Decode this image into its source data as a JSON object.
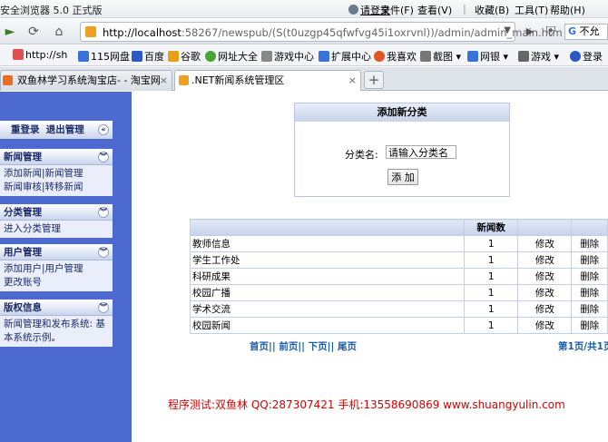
{
  "window": {
    "title": "安全浏览器 5.0 正式版",
    "login": "请登录",
    "menu": [
      "文件(F)",
      "查看(V)",
      "收藏(B)",
      "工具(T)",
      "帮助(H)"
    ]
  },
  "nav": {
    "url_host": "http://localhost",
    "url_rest": ":58267/newspub/(S(t0uzgp45qfwfvg45i1oxrvnl))/admin/admin_main.htm",
    "search_text": "不允",
    "icons": [
      "forward-icon",
      "refresh-icon",
      "home-icon"
    ]
  },
  "bookmarks": [
    {
      "label": "http://sh",
      "color": "#e05050"
    },
    {
      "label": "115网盘",
      "color": "#3a73d8"
    },
    {
      "label": "百度",
      "color": "#2b59c3"
    },
    {
      "label": "谷歌",
      "color": "#e6a017"
    },
    {
      "label": "网址大全",
      "color": "#4aa431"
    },
    {
      "label": "游戏中心",
      "color": "#888888"
    },
    {
      "label": "扩展中心",
      "color": "#3a73d8"
    },
    {
      "label": "我喜欢",
      "color": "#e25520"
    },
    {
      "label": "截图",
      "color": "#777777"
    },
    {
      "label": "网银",
      "color": "#3a73d8"
    },
    {
      "label": "游戏",
      "color": "#666666"
    },
    {
      "label": "登录",
      "color": "#2b59c3"
    }
  ],
  "tabs": [
    {
      "label": "双鱼林学习系统淘宝店- - 淘宝网",
      "close": "×"
    },
    {
      "label": ".NET新闻系统管理区",
      "close": "×"
    }
  ],
  "new_tab": "+",
  "sidebar": {
    "top_links": "重登录  退出管理",
    "sections": [
      {
        "title": "新闻管理",
        "lines": [
          "添加新闻|新闻管理",
          "新闻审核|转移新闻"
        ]
      },
      {
        "title": "分类管理",
        "lines": [
          "进入分类管理"
        ]
      },
      {
        "title": "用户管理",
        "lines": [
          "添加用户|用户管理",
          "更改账号"
        ]
      },
      {
        "title": "版权信息",
        "lines": [
          "新闻管理和发布系统: 基本系统示例。"
        ]
      }
    ]
  },
  "add_panel": {
    "title": "添加新分类",
    "label": "分类名:",
    "input_value": "请输入分类名",
    "button": "添 加"
  },
  "table": {
    "header": [
      "",
      "新闻数",
      "",
      ""
    ],
    "rows": [
      {
        "name": "教师信息",
        "count": "1",
        "edit": "修改",
        "delete": "删除"
      },
      {
        "name": "学生工作处",
        "count": "1",
        "edit": "修改",
        "delete": "删除"
      },
      {
        "name": "科研成果",
        "count": "1",
        "edit": "修改",
        "delete": "删除"
      },
      {
        "name": "校园广播",
        "count": "1",
        "edit": "修改",
        "delete": "删除"
      },
      {
        "name": "学术交流",
        "count": "1",
        "edit": "修改",
        "delete": "删除"
      },
      {
        "name": "校园新闻",
        "count": "1",
        "edit": "修改",
        "delete": "删除"
      }
    ]
  },
  "pager": {
    "links": "首页|| 前页|| 下页|| 尾页",
    "info": "第1页/共1页"
  },
  "footer": "程序测试:双鱼林 QQ:287307421 手机:13558690869 www.shuangyulin.com",
  "chevron": "«",
  "chevron_down": "»"
}
